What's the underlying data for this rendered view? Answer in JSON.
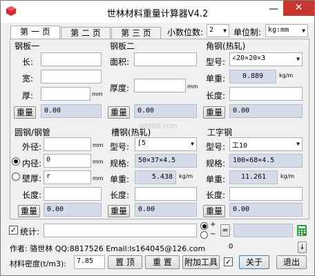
{
  "window": {
    "title": "世林材料重量计算器V4.2",
    "minimize": "—",
    "close": "✕"
  },
  "tabs": [
    "第 一 页",
    "第 二 页",
    "第 三 页"
  ],
  "settings": {
    "decimal_label": "小数位数:",
    "decimal_value": "2",
    "unit_label": "单位制:",
    "unit_value": "kg:mm"
  },
  "plate1": {
    "title": "钢板一",
    "length_label": "长:",
    "width_label": "宽:",
    "thick_label": "厚:",
    "unit_mm": "mm",
    "weight_btn": "重量",
    "weight_value": "0.00"
  },
  "plate2": {
    "title": "钢板二",
    "area_label": "面积:",
    "thick_label": "厚度:",
    "unit_mm": "mm",
    "weight_btn": "重量",
    "weight_value": "0.00"
  },
  "angle": {
    "title": "角钢(热轧)",
    "model_label": "型号:",
    "model_value": "∠20×20×3",
    "unit_weight_label": "单重:",
    "unit_weight_value": "0.889",
    "unit_weight_unit": "kg/m",
    "length_label": "长度:",
    "weight_btn": "重量",
    "weight_value": "0.00"
  },
  "round": {
    "title": "圆钢/钢管",
    "outer_label": "外径:",
    "inner_label": "内径:",
    "inner_value": "0",
    "wall_label": "壁厚:",
    "wall_value": "r",
    "unit_mm": "mm",
    "length_label": "长度:",
    "weight_btn": "重量",
    "weight_value": "0.00"
  },
  "channel": {
    "title": "槽钢(热轧)",
    "model_label": "型号:",
    "model_value": "[5",
    "spec_label": "规格:",
    "spec_value": "50×37×4.5",
    "unit_weight_label": "单重:",
    "unit_weight_value": "5.438",
    "unit_weight_unit": "kg/m",
    "length_label": "长度:",
    "weight_btn": "重量",
    "weight_value": "0.00"
  },
  "ibeam": {
    "title": "工字钢",
    "model_label": "型号:",
    "model_value": "工10",
    "spec_label": "规格:",
    "spec_value": "100×68×4.5",
    "unit_weight_label": "单重:",
    "unit_weight_value": "11.261",
    "unit_weight_unit": "kg/m",
    "length_label": "长度:",
    "weight_btn": "重量",
    "weight_value": "0.00"
  },
  "stats": {
    "label": "统计:",
    "plus": "+",
    "minus": "−",
    "equals": "="
  },
  "footer": {
    "author": "作者: 骆世林 QQ:8817526  Email:ls164045@126.com",
    "count": "0",
    "density_label": "材料密度(t/m3):",
    "density_value": "7.85",
    "pin_btn": "置 顶",
    "reset_btn": "重 置",
    "tools_btn": "附加工具",
    "about_btn": "关于",
    "exit_btn": "退出"
  },
  "watermark": "ws688.com",
  "icons": {
    "app": "red-cube-icon",
    "calculator": "calculator-icon",
    "down": "down-arrow-icon"
  },
  "colors": {
    "close_button": "#c7372f",
    "output_field": "#d6dbe9",
    "app_icon": "#d9262b",
    "calculator_icon": "#2e9e3e"
  }
}
